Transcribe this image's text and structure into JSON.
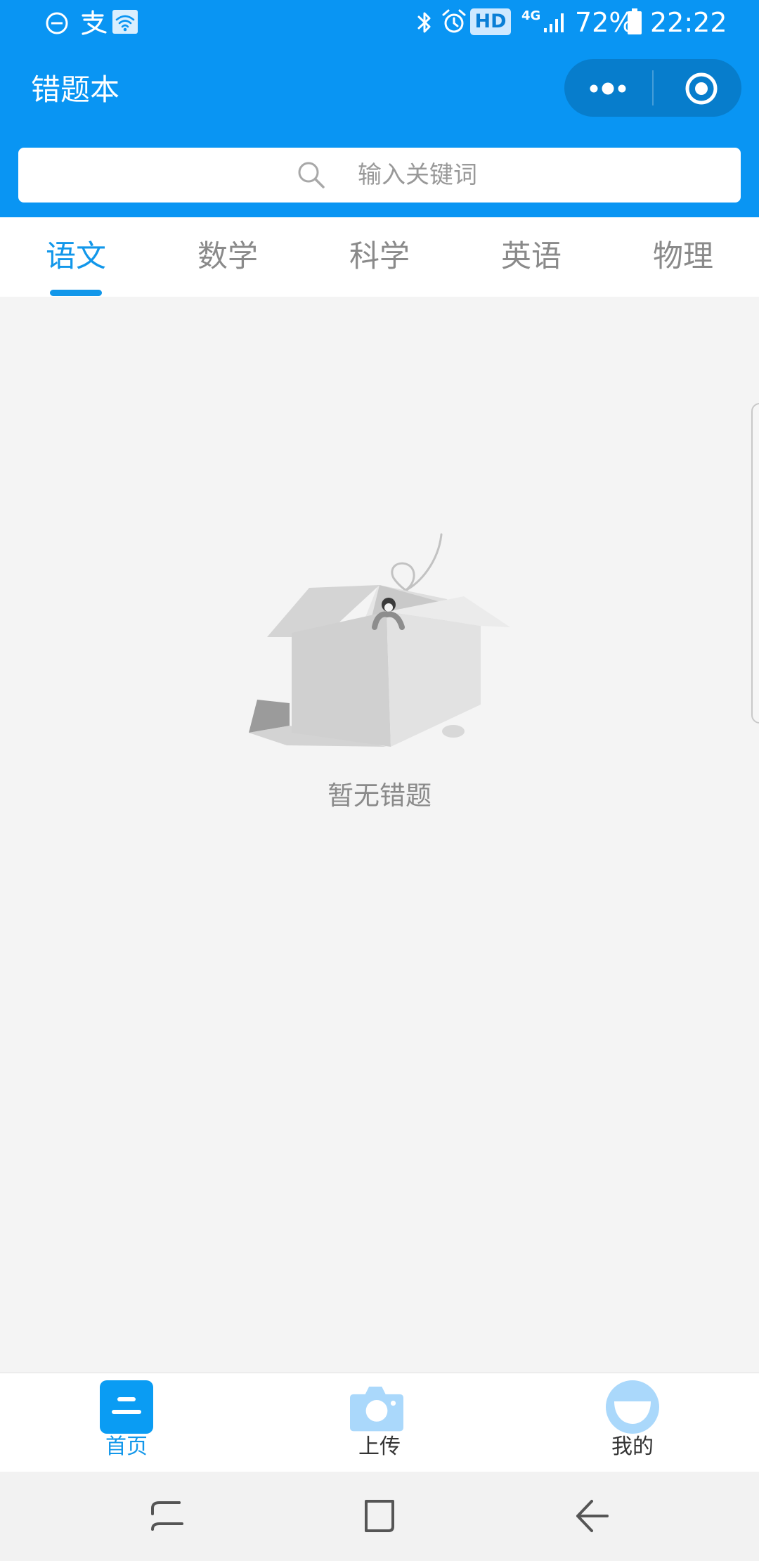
{
  "status_bar": {
    "battery_percent": "72%",
    "time": "22:22",
    "hd_badge": "HD",
    "network": "4G",
    "icons": [
      "dnd-icon",
      "alipay-icon",
      "wifi-icon",
      "bluetooth-icon",
      "alarm-icon",
      "hd-icon",
      "signal-icon",
      "battery-icon"
    ]
  },
  "header": {
    "title": "错题本",
    "capsule": {
      "more_icon": "more-dots-icon",
      "close_icon": "target-close-icon"
    },
    "background_color": "#0995f3"
  },
  "search": {
    "placeholder": "输入关键词",
    "icon": "search-icon"
  },
  "tabs": [
    {
      "label": "语文",
      "active": true
    },
    {
      "label": "数学",
      "active": false
    },
    {
      "label": "科学",
      "active": false
    },
    {
      "label": "英语",
      "active": false
    },
    {
      "label": "物理",
      "active": false
    }
  ],
  "empty_state": {
    "message": "暂无错题",
    "illustration": "empty-box-illustration"
  },
  "bottom_nav": [
    {
      "label": "首页",
      "icon": "home-icon",
      "active": true
    },
    {
      "label": "上传",
      "icon": "camera-icon",
      "active": false
    },
    {
      "label": "我的",
      "icon": "profile-icon",
      "active": false
    }
  ],
  "system_nav": {
    "buttons": [
      "recents-icon",
      "home-square-icon",
      "back-icon"
    ]
  },
  "colors": {
    "accent": "#1297ea",
    "background": "#f4f4f4",
    "inactive_text": "#8a8a8a"
  }
}
